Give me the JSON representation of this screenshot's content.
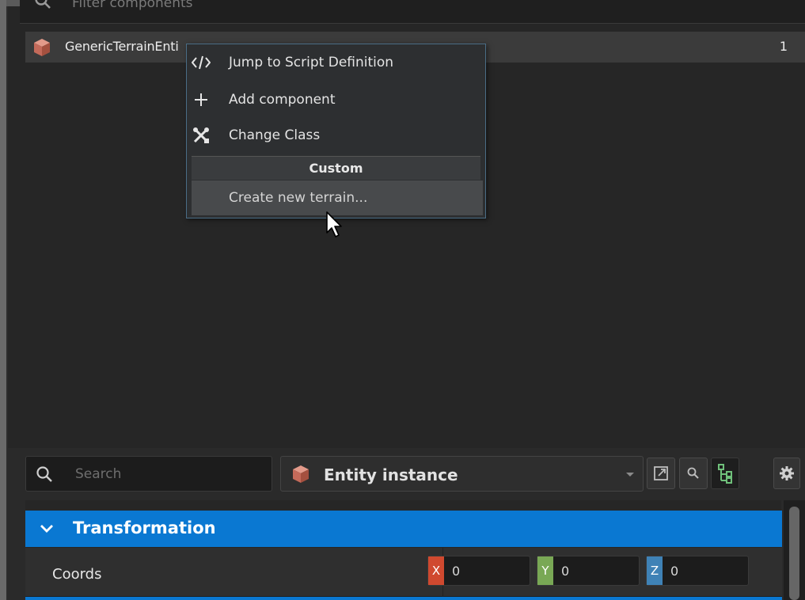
{
  "filter": {
    "placeholder": "Filter components"
  },
  "component_list": {
    "items": [
      {
        "name": "GenericTerrainEnti",
        "count": "1"
      }
    ]
  },
  "context_menu": {
    "items": [
      {
        "icon": "code-icon",
        "label": "Jump to Script Definition"
      },
      {
        "icon": "plus-icon",
        "label": "Add component"
      },
      {
        "icon": "tools-icon",
        "label": "Change Class"
      }
    ],
    "section_header": "Custom",
    "custom_items": [
      {
        "label": "Create new terrain...",
        "hovered": true
      }
    ]
  },
  "toolbar": {
    "search_placeholder": "Search",
    "entity_type_label": "Entity instance"
  },
  "properties": {
    "section_title": "Transformation",
    "coords": {
      "label": "Coords",
      "x": {
        "axis": "X",
        "value": "0"
      },
      "y": {
        "axis": "Y",
        "value": "0"
      },
      "z": {
        "axis": "Z",
        "value": "0"
      }
    }
  },
  "colors": {
    "accent": "#0a78d2",
    "axis_x": "#d0492f",
    "axis_y": "#79a855",
    "axis_z": "#3f82b6",
    "menu_border": "#4a6d86",
    "cube": "#c46a5a"
  }
}
